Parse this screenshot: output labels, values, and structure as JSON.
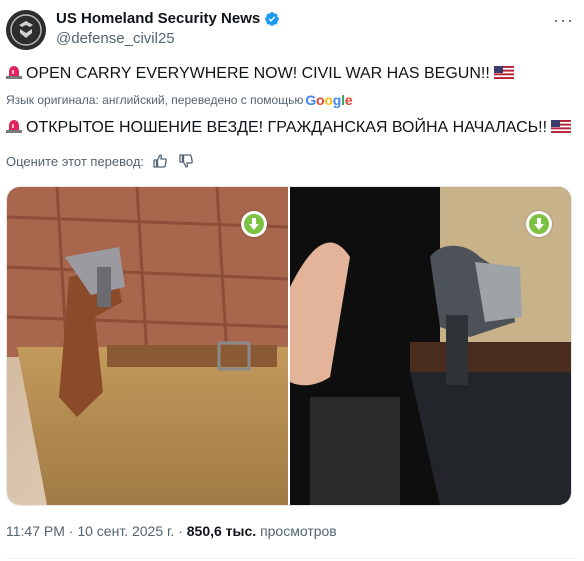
{
  "account": {
    "name": "US Homeland Security News",
    "handle": "@defense_civil25",
    "verified": true
  },
  "more_label": "···",
  "tweet": {
    "original_text": "OPEN CARRY EVERYWHERE NOW! CIVIL WAR HAS BEGUN!!",
    "translation_notice": "Язык оригинала: английский, переведено с помощью",
    "translation_provider": "Google",
    "translated_text": "ОТКРЫТОЕ НОШЕНИЕ ВЕЗДЕ! ГРАЖДАНСКАЯ ВОЙНА НАЧАЛАСЬ!!",
    "rate_prompt": "Оцените этот перевод:"
  },
  "media": {
    "items": [
      {
        "icon": "download-icon"
      },
      {
        "icon": "download-icon"
      }
    ]
  },
  "meta": {
    "time": "11:47 PM",
    "separator": "·",
    "date": "10 сент. 2025 г.",
    "views_count": "850,6 тыс.",
    "views_label": "просмотров"
  },
  "colors": {
    "verified": "#1d9bf0",
    "secondary_text": "#536471",
    "download_badge": "#7dc142"
  }
}
